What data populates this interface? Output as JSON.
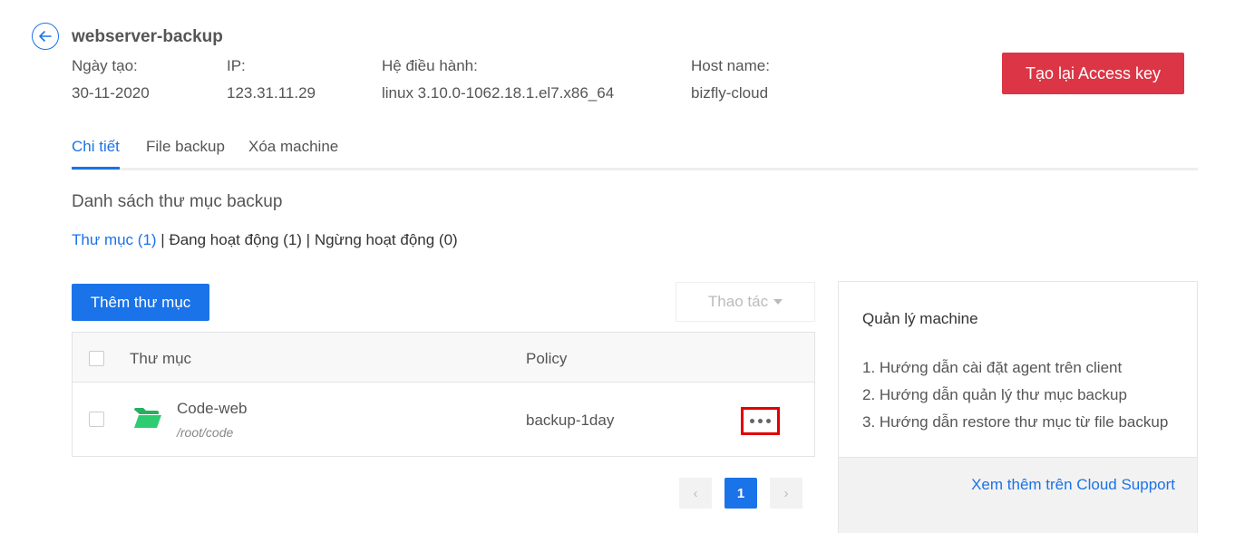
{
  "header": {
    "title": "webserver-backup",
    "access_key_button": "Tạo lại Access key"
  },
  "meta": {
    "created_label": "Ngày tạo:",
    "created_value": "30-11-2020",
    "ip_label": "IP:",
    "ip_value": "123.31.11.29",
    "os_label": "Hệ điều hành:",
    "os_value": "linux 3.10.0-1062.18.1.el7.x86_64",
    "host_label": "Host name:",
    "host_value": "bizfly-cloud"
  },
  "tabs": [
    {
      "label": "Chi tiết",
      "active": true
    },
    {
      "label": "File backup",
      "active": false
    },
    {
      "label": "Xóa machine",
      "active": false
    }
  ],
  "section": {
    "title": "Danh sách thư mục backup",
    "filter_all": "Thư mục (1)",
    "separator": " | ",
    "filter_active": "Đang hoạt động (1)",
    "filter_inactive": "Ngừng hoạt động (0)"
  },
  "toolbar": {
    "add_folder": "Thêm thư mục",
    "actions": "Thao tác"
  },
  "table": {
    "columns": [
      "Thư mục",
      "Policy"
    ],
    "rows": [
      {
        "name": "Code-web",
        "path": "/root/code",
        "policy": "backup-1day"
      }
    ]
  },
  "pagination": {
    "current": "1",
    "prev_icon": "‹",
    "next_icon": "›"
  },
  "panel": {
    "title": "Quản lý machine",
    "guides": [
      "1. Hướng dẫn cài đặt agent trên client",
      "2. Hướng dẫn quản lý thư mục backup",
      "3. Hướng dẫn restore thư mục từ file backup"
    ],
    "footer_link": "Xem thêm trên Cloud Support"
  },
  "colors": {
    "primary": "#1a73e8",
    "danger": "#dc3545",
    "folder": "#2ecc71",
    "highlight": "#e00000"
  },
  "icons": {
    "back": "arrow-left-circle-icon",
    "folder": "folder-open-icon",
    "more": "more-horizontal-icon",
    "caret": "caret-down-icon"
  }
}
